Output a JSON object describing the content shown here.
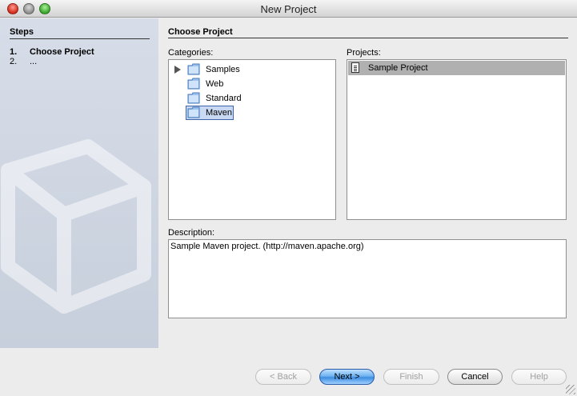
{
  "window": {
    "title": "New Project"
  },
  "steps": {
    "heading": "Steps",
    "items": [
      {
        "num": "1.",
        "label": "Choose Project"
      },
      {
        "num": "2.",
        "label": "..."
      }
    ]
  },
  "main": {
    "heading": "Choose Project",
    "categories": {
      "label": "Categories:",
      "items": [
        {
          "label": "Samples",
          "expandable": true
        },
        {
          "label": "Web"
        },
        {
          "label": "Standard"
        },
        {
          "label": "Maven",
          "selected": true
        }
      ]
    },
    "projects": {
      "label": "Projects:",
      "items": [
        {
          "label": "Sample Project",
          "selected": true
        }
      ]
    },
    "description": {
      "label": "Description:",
      "text": "Sample Maven project. (http://maven.apache.org)"
    }
  },
  "buttons": {
    "back": "< Back",
    "next": "Next >",
    "finish": "Finish",
    "cancel": "Cancel",
    "help": "Help"
  },
  "icons": {
    "close": "close-button-icon",
    "minimize": "minimize-button-icon",
    "zoom": "zoom-button-icon",
    "folder": "folder-icon",
    "project": "project-file-icon",
    "expander": "triangle-right-icon"
  },
  "colors": {
    "selection": "#c9d9f3",
    "selection_border": "#3d64a8",
    "project_selection": "#b0b0b0",
    "primary_button": "#3d8de0"
  }
}
